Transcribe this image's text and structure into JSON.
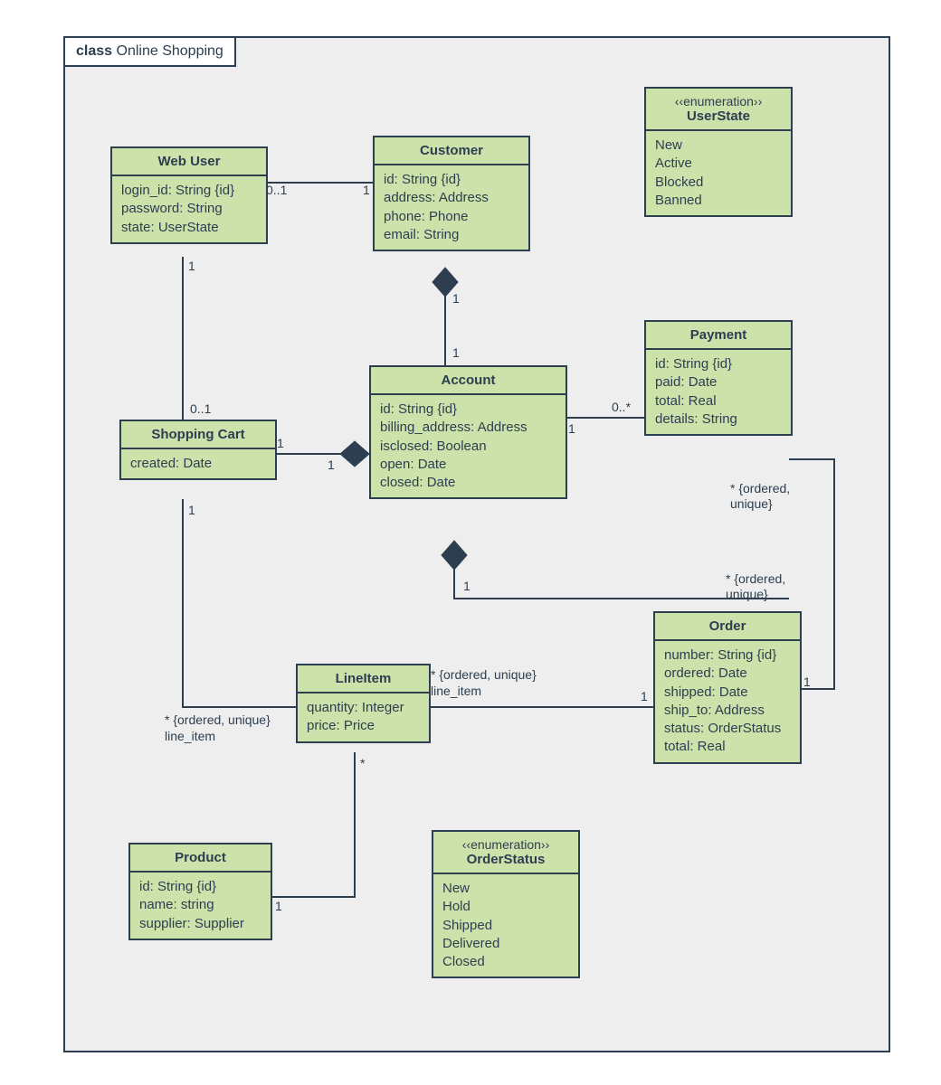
{
  "diagram": {
    "title_prefix": "class",
    "title": "Online Shopping"
  },
  "classes": {
    "webuser": {
      "name": "Web User",
      "attrs": [
        "login_id: String {id}",
        "password: String",
        "state: UserState"
      ]
    },
    "customer": {
      "name": "Customer",
      "attrs": [
        "id: String {id}",
        "address: Address",
        "phone: Phone",
        "email: String"
      ]
    },
    "userstate": {
      "stereotype": "‹‹enumeration››",
      "name": "UserState",
      "attrs": [
        "New",
        "Active",
        "Blocked",
        "Banned"
      ]
    },
    "shoppingcart": {
      "name": "Shopping Cart",
      "attrs": [
        "created: Date"
      ]
    },
    "account": {
      "name": "Account",
      "attrs": [
        "id: String {id}",
        "billing_address: Address",
        "isclosed: Boolean",
        "open: Date",
        "closed: Date"
      ]
    },
    "payment": {
      "name": "Payment",
      "attrs": [
        "id: String {id}",
        "paid: Date",
        "total: Real",
        "details: String"
      ]
    },
    "lineitem": {
      "name": "LineItem",
      "attrs": [
        "quantity: Integer",
        "price: Price"
      ]
    },
    "order": {
      "name": "Order",
      "attrs": [
        "number: String {id}",
        "ordered: Date",
        "shipped: Date",
        "ship_to: Address",
        "status: OrderStatus",
        "total: Real"
      ]
    },
    "product": {
      "name": "Product",
      "attrs": [
        "id: String {id}",
        "name: string",
        "supplier: Supplier"
      ]
    },
    "orderstatus": {
      "stereotype": "‹‹enumeration››",
      "name": "OrderStatus",
      "attrs": [
        "New",
        "Hold",
        "Shipped",
        "Delivered",
        "Closed"
      ]
    }
  },
  "labels": {
    "m_0_1_a": "0..1",
    "m_0_1_b": "0..1",
    "m_0_star": "0..*",
    "m_1": "1",
    "m_star": "*",
    "c_ordered_unique": "* {ordered,\nunique}",
    "c_ordered_unique_inline": "* {ordered, unique}",
    "role_line_item": "line_item"
  }
}
